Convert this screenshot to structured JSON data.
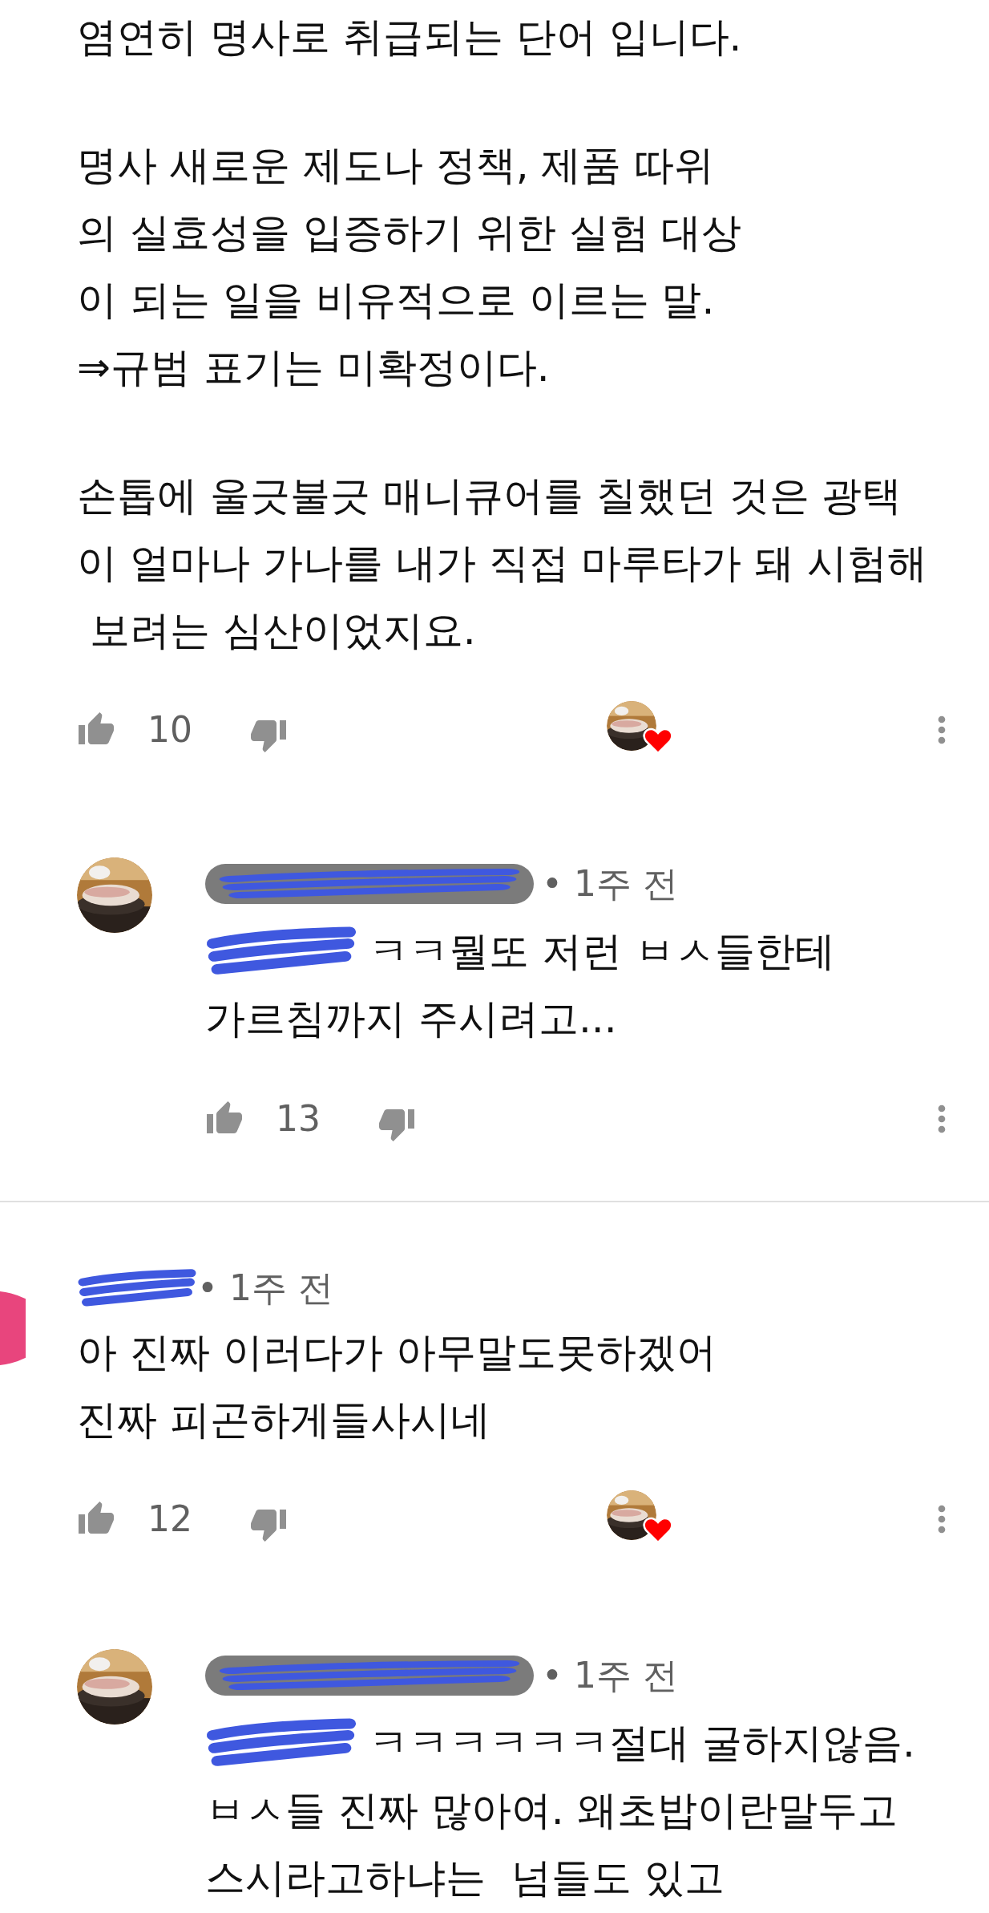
{
  "comments": [
    {
      "kind": "continued",
      "paragraphs": [
        "염연히 명사로 취급되는 단어 입니다.",
        "명사 새로운 제도나 정책, 제품 따위\n의 실효성을 입증하기 위한 실험 대상\n이 되는 일을 비유적으로 이르는 말.\n⇒규범 표기는 미확정이다.",
        "손톱에 울긋불긋 매니큐어를 칠했던 것은 광택\n이 얼마나 가나를 내가 직접 마루타가 돼 시험해\n 보려는 심산이었지요."
      ],
      "likes": "10",
      "creator_heart": true,
      "replies": [
        {
          "time": "• 1주 전",
          "author_badge": true,
          "mention_redacted": true,
          "first_line": "ㅋㅋ뭘또 저런 ㅂㅅ들한테",
          "text": "가르침까지 주시려고...",
          "likes": "13",
          "creator_heart": false
        }
      ]
    },
    {
      "kind": "full",
      "time": "• 1주 전",
      "paragraphs": [
        "아 진짜 이러다가 아무말도못하겠어\n진짜 피곤하게들사시네"
      ],
      "likes": "12",
      "creator_heart": true,
      "replies": [
        {
          "time": "• 1주 전",
          "author_badge": true,
          "mention_redacted": true,
          "first_line": "ㅋㅋㅋㅋㅋㅋ절대 굴하지않음.",
          "text": "ㅂㅅ들 진짜 많아여. 왜초밥이란말두고\n스시라고하냐는  넘들도 있고"
        }
      ]
    }
  ]
}
